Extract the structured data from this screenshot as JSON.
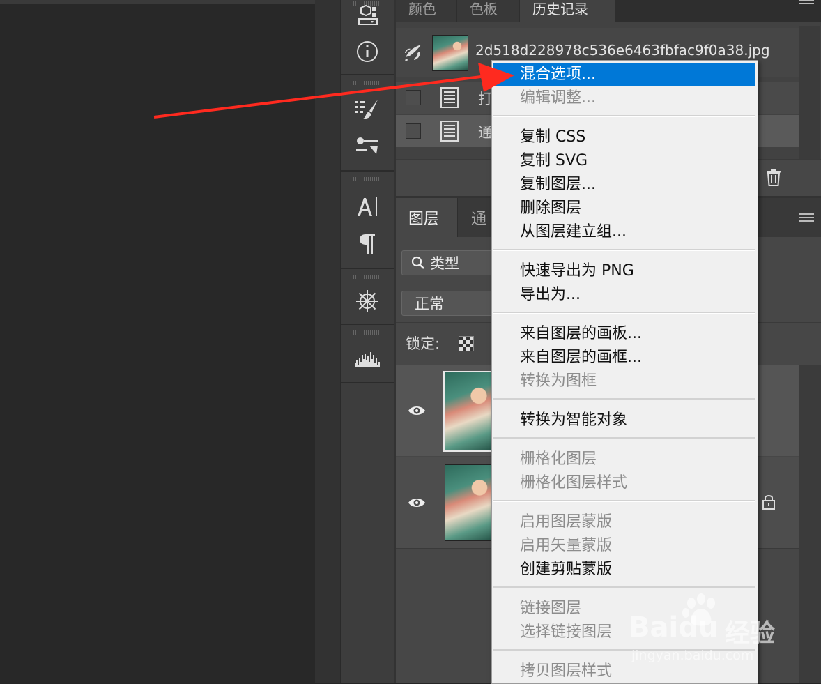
{
  "history_panel": {
    "tabs": [
      "颜色",
      "色板",
      "历史记录"
    ],
    "active_tab": "历史记录",
    "snapshot_name": "2d518d228978c536e6463fbfac9f0a38.jpg",
    "steps": [
      "打",
      "通"
    ]
  },
  "layers_panel": {
    "tabs": [
      "图层",
      "通"
    ],
    "filter_label": "类型",
    "blend_mode": "正常",
    "lock_label": "锁定:"
  },
  "context_menu": {
    "groups": [
      [
        {
          "label": "混合选项...",
          "enabled": true,
          "highlighted": true
        },
        {
          "label": "编辑调整...",
          "enabled": false
        }
      ],
      [
        {
          "label": "复制 CSS",
          "enabled": true
        },
        {
          "label": "复制 SVG",
          "enabled": true
        },
        {
          "label": "复制图层...",
          "enabled": true
        },
        {
          "label": "删除图层",
          "enabled": true
        },
        {
          "label": "从图层建立组...",
          "enabled": true
        }
      ],
      [
        {
          "label": "快速导出为 PNG",
          "enabled": true
        },
        {
          "label": "导出为...",
          "enabled": true
        }
      ],
      [
        {
          "label": "来自图层的画板...",
          "enabled": true
        },
        {
          "label": "来自图层的画框...",
          "enabled": true
        },
        {
          "label": "转换为图框",
          "enabled": false
        }
      ],
      [
        {
          "label": "转换为智能对象",
          "enabled": true
        }
      ],
      [
        {
          "label": "栅格化图层",
          "enabled": false
        },
        {
          "label": "栅格化图层样式",
          "enabled": false
        }
      ],
      [
        {
          "label": "启用图层蒙版",
          "enabled": false
        },
        {
          "label": "启用矢量蒙版",
          "enabled": false
        },
        {
          "label": "创建剪贴蒙版",
          "enabled": true
        }
      ],
      [
        {
          "label": "链接图层",
          "enabled": false
        },
        {
          "label": "选择链接图层",
          "enabled": false
        }
      ],
      [
        {
          "label": "拷贝图层样式",
          "enabled": false
        }
      ]
    ]
  },
  "toolstrip": {
    "icons": [
      "3d-cube-icon",
      "info-icon",
      "brush-presets-icon",
      "adjustments-icon",
      "character-icon",
      "paragraph-icon",
      "navigator-wheel-icon",
      "histogram-icon"
    ]
  },
  "annotation": {
    "arrow_color": "#ff2a1f"
  },
  "watermark": {
    "brand": "Bai",
    "brand_suffix": "du",
    "product": "经验",
    "url": "jingyan.baidu.com"
  },
  "colors": {
    "menu_highlight": "#0078d7",
    "menu_bg": "#f0f0f0",
    "panel_bg": "#474747"
  }
}
